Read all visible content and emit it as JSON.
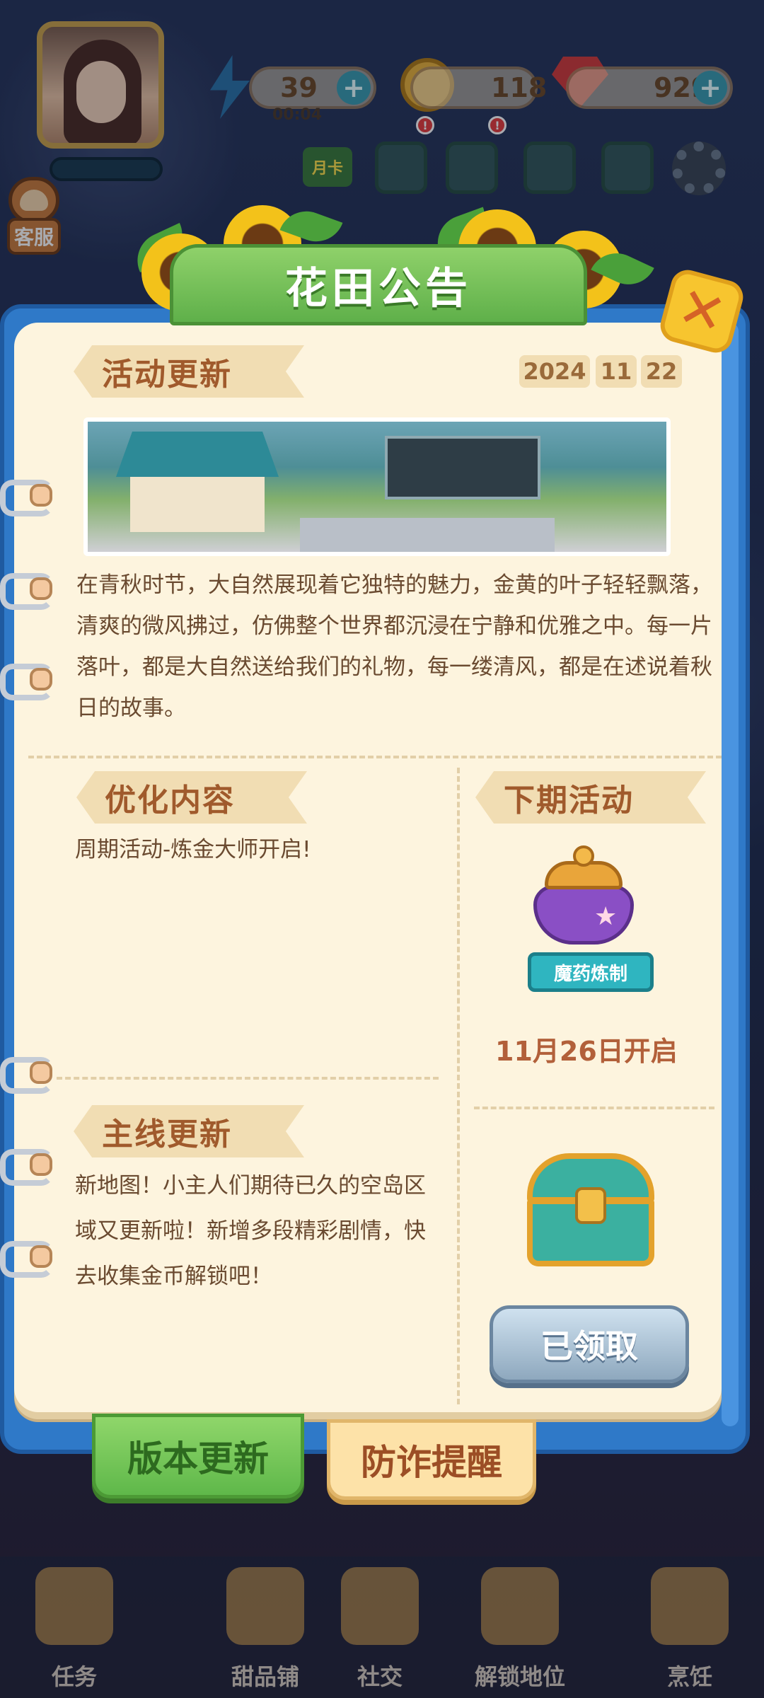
{
  "hud": {
    "energy": "39",
    "energy_timer": "00:04",
    "coins": "118",
    "gems": "929",
    "plus": "+",
    "customer_service": "客服",
    "monthly_card": "月卡",
    "alert": "!"
  },
  "popup": {
    "title": "花田公告",
    "close": "✕",
    "activity": {
      "heading": "活动更新",
      "date_year": "2024",
      "date_month": "11",
      "date_day": "22",
      "body": "在青秋时节，大自然展现着它独特的魅力，金黄的叶子轻轻飘落，清爽的微风拂过，仿佛整个世界都沉浸在宁静和优雅之中。每一片落叶，都是大自然送给我们的礼物，每一缕清风，都是在述说着秋日的故事。"
    },
    "optimization": {
      "heading": "优化内容",
      "body": "周期活动-炼金大师开启!"
    },
    "next_event": {
      "heading": "下期活动",
      "event_name": "魔药炼制",
      "start_text": "11月26日开启"
    },
    "main_update": {
      "heading": "主线更新",
      "body": "新地图！小主人们期待已久的空岛区域又更新啦！新增多段精彩剧情，快去收集金币解锁吧！"
    },
    "reward": {
      "claim_label": "已领取",
      "claimed": true
    },
    "tabs": [
      {
        "label": "版本更新",
        "active": true
      },
      {
        "label": "防诈提醒",
        "active": false
      }
    ]
  },
  "bottom_nav": [
    {
      "label": "任务",
      "icon": "task-icon"
    },
    {
      "label": "甜品铺",
      "icon": "shop-icon"
    },
    {
      "label": "社交",
      "icon": "social-icon"
    },
    {
      "label": "解锁地位",
      "icon": "lock-icon"
    },
    {
      "label": "烹饪",
      "icon": "cooking-icon"
    }
  ],
  "colors": {
    "paper": "#fdf4de",
    "title_green": "#5fb04a",
    "ribbon": "#f1ddb3",
    "heading_brown": "#a05a2c",
    "binder_blue": "#2f79c8"
  }
}
